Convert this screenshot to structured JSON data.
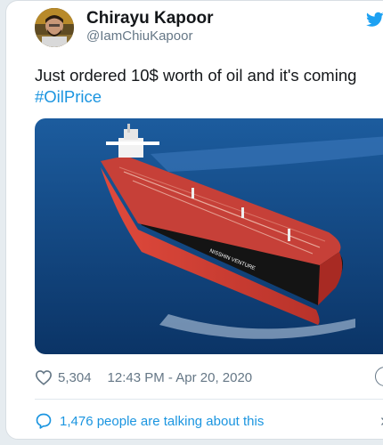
{
  "tweet": {
    "author_name": "Chirayu Kapoor",
    "author_handle": "@IamChiuKapoor",
    "text": "Just ordered 10$ worth of oil and it's coming",
    "hashtag": "#OilPrice",
    "ship_name": "NISSHIN VENTURE"
  },
  "meta": {
    "likes": "5,304",
    "timestamp": "12:43 PM - Apr 20, 2020",
    "info_glyph": "i"
  },
  "conversation": {
    "label": "1,476 people are talking about this",
    "chevron": "›"
  },
  "colors": {
    "link": "#1b95e0",
    "muted": "#657786",
    "text": "#14171a",
    "hull_red": "#d9403a",
    "deck_red": "#c9423c",
    "sea": "#0f3f78"
  },
  "icons": [
    "twitter-bird-icon",
    "heart-icon",
    "info-icon",
    "speech-bubble-icon",
    "chevron-right-icon"
  ]
}
